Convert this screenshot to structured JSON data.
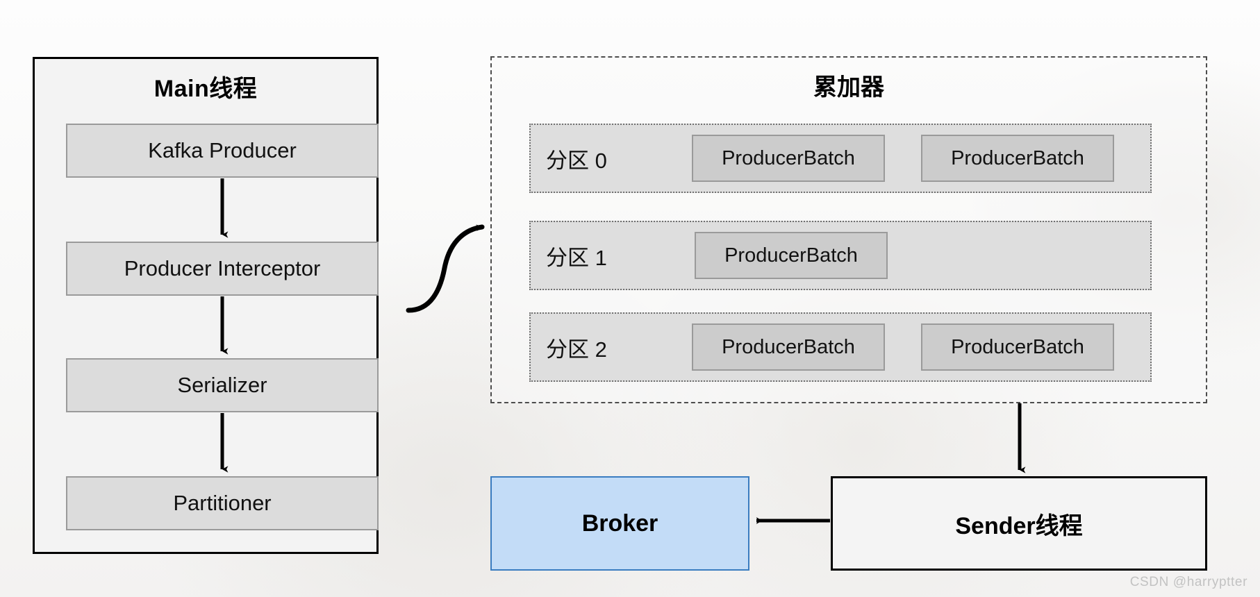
{
  "diagram": {
    "title_watermark": "CSDN @harryptter",
    "main_thread": {
      "title": "Main线程",
      "steps": [
        {
          "label": "Kafka Producer"
        },
        {
          "label": "Producer Interceptor"
        },
        {
          "label": "Serializer"
        },
        {
          "label": "Partitioner"
        }
      ]
    },
    "accumulator": {
      "title": "累加器",
      "partitions": [
        {
          "label": "分区 0",
          "batches": [
            "ProducerBatch",
            "ProducerBatch"
          ]
        },
        {
          "label": "分区 1",
          "batches": [
            "ProducerBatch"
          ]
        },
        {
          "label": "分区 2",
          "batches": [
            "ProducerBatch",
            "ProducerBatch"
          ]
        }
      ]
    },
    "broker": {
      "label": "Broker"
    },
    "sender": {
      "label": "Sender线程"
    },
    "colors": {
      "broker_fill": "#c3dcf7",
      "broker_border": "#3a7cc0",
      "process_box_fill": "#dcdcdc",
      "batch_box_fill": "#cccccc",
      "panel_border": "#000000",
      "dashed_border": "#4c4c4c"
    },
    "connectors": [
      {
        "from": "Kafka Producer",
        "to": "Producer Interceptor",
        "kind": "arrow-down"
      },
      {
        "from": "Producer Interceptor",
        "to": "Serializer",
        "kind": "arrow-down"
      },
      {
        "from": "Serializer",
        "to": "Partitioner",
        "kind": "arrow-down"
      },
      {
        "from": "Main线程",
        "to": "累加器",
        "kind": "curved-arrow-right"
      },
      {
        "from": "累加器",
        "to": "Sender线程",
        "kind": "arrow-down"
      },
      {
        "from": "Sender线程",
        "to": "Broker",
        "kind": "arrow-left"
      }
    ]
  }
}
